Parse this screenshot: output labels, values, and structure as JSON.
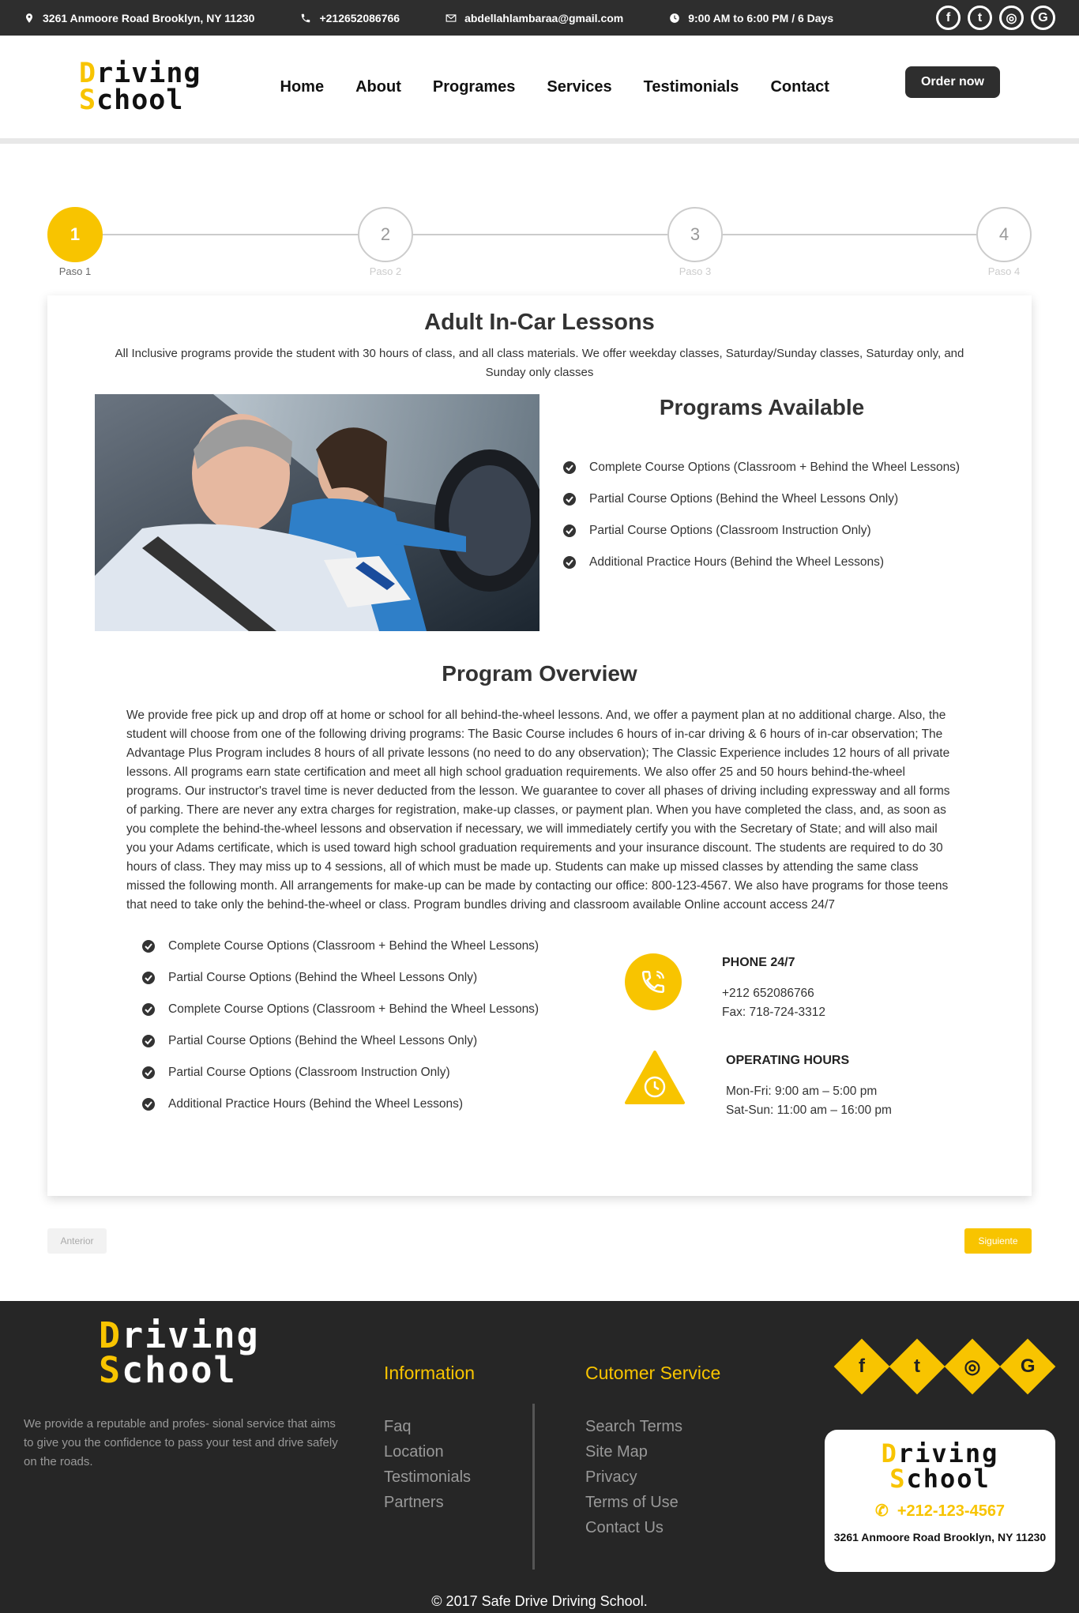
{
  "topbar": {
    "address": "3261 Anmoore Road Brooklyn, NY 11230",
    "phone": "+212652086766",
    "email": "abdellahlambaraa@gmail.com",
    "hours": "9:00 AM to 6:00 PM / 6 Days",
    "social": [
      "facebook-icon",
      "twitter-icon",
      "instagram-icon",
      "google-icon"
    ]
  },
  "logo": {
    "line1_first": "D",
    "line1_rest": "riving",
    "line2_first": "S",
    "line2_rest": "chool"
  },
  "nav": [
    "Home",
    "About",
    "Programes",
    "Services",
    "Testimonials",
    "Contact"
  ],
  "order_label": "Order now",
  "steps": [
    {
      "num": "1",
      "label": "Paso 1",
      "active": true
    },
    {
      "num": "2",
      "label": "Paso 2",
      "active": false
    },
    {
      "num": "3",
      "label": "Paso 3",
      "active": false
    },
    {
      "num": "4",
      "label": "Paso 4",
      "active": false
    }
  ],
  "main": {
    "title": "Adult In-Car Lessons",
    "intro": "All Inclusive programs provide the student with 30 hours of class, and all class materials. We offer weekday classes, Saturday/Sunday classes, Saturday only, and Sunday only classes",
    "programs_title": "Programs Available",
    "programs": [
      "Complete Course Options (Classroom + Behind the Wheel Lessons)",
      "Partial Course Options (Behind the Wheel Lessons Only)",
      "Partial Course Options (Classroom Instruction Only)",
      "Additional Practice Hours (Behind the Wheel Lessons)"
    ],
    "overview_title": "Program Overview",
    "overview": "We provide free pick up and drop off at home or school for all behind-the-wheel lessons. And, we offer a payment plan at no additional charge. Also, the student will choose from one of the following driving programs: The Basic Course includes 6 hours of in-car driving & 6 hours of in-car observation; The Advantage Plus Program includes 8 hours of all private lessons (no need to do any observation); The Classic Experience includes 12 hours of all private lessons. All programs earn state certification and meet all high school graduation requirements. We also offer 25 and 50 hours behind-the-wheel programs. Our instructor's travel time is never deducted from the lesson. We guarantee to cover all phases of driving including expressway and all forms of parking. There are never any extra charges for registration, make-up classes, or payment plan. When you have completed the class, and, as soon as you complete the behind-the-wheel lessons and observation if necessary, we will immediately certify you with the Secretary of State; and will also mail you your Adams certificate, which is used toward high school graduation requirements and your insurance discount. The students are required to do 30 hours of class. They may miss up to 4 sessions, all of which must be made up. Students can make up missed classes by attending the same class missed the following month. All arrangements for make-up can be made by contacting our office: 800-123-4567. We also have programs for those teens that need to take only the behind-the-wheel or class. Program bundles driving and classroom available Online account access 24/7",
    "options": [
      "Complete Course Options (Classroom + Behind the Wheel Lessons)",
      "Partial Course Options (Behind the Wheel Lessons Only)",
      "Complete Course Options (Classroom + Behind the Wheel Lessons)",
      "Partial Course Options (Behind the Wheel Lessons Only)",
      "Partial Course Options (Classroom Instruction Only)",
      "Additional Practice Hours (Behind the Wheel Lessons)"
    ],
    "phone_title": "PHONE 24/7",
    "phone_line1": "+212 652086766",
    "phone_line2": "Fax: 718-724-3312",
    "hours_title": "OPERATING HOURS",
    "hours_line1": "Mon-Fri: 9:00 am – 5:00 pm",
    "hours_line2": "Sat-Sun: 11:00 am – 16:00 pm"
  },
  "pager": {
    "prev": "Anterior",
    "next": "Siguiente"
  },
  "footer": {
    "description": "We provide a reputable and profes- sional service that aims to give you the confidence to pass your test and drive safely on the roads.",
    "info_title": "Information",
    "info_links": [
      "Faq",
      "Location",
      "Testimonials",
      "Partners"
    ],
    "service_title": "Cutomer Service",
    "service_links": [
      "Search Terms",
      "Site Map",
      "Privacy",
      "Terms of Use",
      "Contact Us"
    ],
    "card_phone": "+212-123-4567",
    "card_address": "3261 Anmoore Road Brooklyn, NY 11230",
    "copyright": "© 2017 Safe Drive Driving School."
  },
  "colors": {
    "accent": "#f8c400",
    "dark": "#2e2e2e",
    "footer_bg": "#262626"
  }
}
